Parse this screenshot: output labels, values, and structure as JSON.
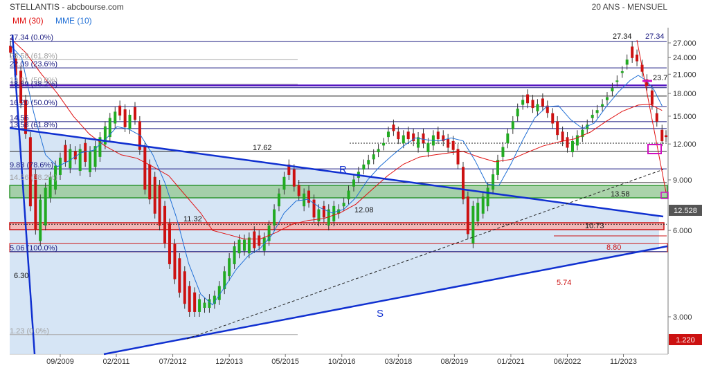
{
  "header": {
    "title": "STELLANTIS - abcbourse.com",
    "period": "20 ANS - MENSUEL"
  },
  "legend": [
    {
      "label": "MM (30)",
      "color": "#e01010"
    },
    {
      "label": "MME (10)",
      "color": "#1f6fd6"
    }
  ],
  "chart_data": {
    "type": "line",
    "title": "STELLANTIS - abcbourse.com",
    "subtitle": "20 ANS - MENSUEL",
    "y_scale": "log",
    "ylim": [
      2.55,
      28.5
    ],
    "y_ticks": [
      "27.000",
      "24.000",
      "21.000",
      "18.000",
      "15.000",
      "12.000",
      "9.000",
      "6.000",
      "3.000"
    ],
    "y_tick_values": [
      27,
      24,
      21,
      18,
      15,
      12,
      9,
      6,
      3
    ],
    "x_ticks": [
      "09/2009",
      "02/2011",
      "07/2012",
      "12/2013",
      "05/2015",
      "10/2016",
      "03/2018",
      "08/2019",
      "01/2021",
      "06/2022",
      "11/2023"
    ],
    "x_tick_dates": [
      2009.67,
      2011.08,
      2012.5,
      2013.92,
      2015.33,
      2016.75,
      2018.17,
      2019.58,
      2021.0,
      2022.42,
      2023.83
    ],
    "x_range": [
      2008.4,
      2024.9
    ],
    "last_value": "12.528",
    "low_marker": "1.220",
    "colors": {
      "price_up": "#22aa22",
      "price_down": "#cc1111",
      "mm30": "#e01010",
      "mme10": "#1f6fd6",
      "trend": "#1030d0",
      "fib": "#1a1a80",
      "fib_faint": "#a0a0a0"
    },
    "series": [
      {
        "name": "MM (30)",
        "color": "#e01010",
        "points": [
          [
            2008.42,
            28.0
          ],
          [
            2008.8,
            25.0
          ],
          [
            2009.2,
            21.0
          ],
          [
            2009.6,
            18.0
          ],
          [
            2010.0,
            15.0
          ],
          [
            2010.4,
            13.0
          ],
          [
            2010.8,
            11.8
          ],
          [
            2011.2,
            11.0
          ],
          [
            2011.6,
            10.7
          ],
          [
            2012.0,
            10.0
          ],
          [
            2012.4,
            9.3
          ],
          [
            2012.8,
            8.0
          ],
          [
            2013.2,
            6.9
          ],
          [
            2013.5,
            6.0
          ],
          [
            2013.9,
            5.8
          ],
          [
            2014.3,
            5.6
          ],
          [
            2014.7,
            5.6
          ],
          [
            2015.1,
            5.9
          ],
          [
            2015.5,
            6.3
          ],
          [
            2015.9,
            6.5
          ],
          [
            2016.3,
            6.6
          ],
          [
            2016.7,
            6.9
          ],
          [
            2017.1,
            7.4
          ],
          [
            2017.5,
            8.3
          ],
          [
            2017.9,
            9.3
          ],
          [
            2018.3,
            10.2
          ],
          [
            2018.7,
            10.8
          ],
          [
            2019.1,
            11.0
          ],
          [
            2019.5,
            11.2
          ],
          [
            2019.8,
            11.3
          ],
          [
            2020.2,
            10.8
          ],
          [
            2020.6,
            10.4
          ],
          [
            2021.0,
            10.6
          ],
          [
            2021.4,
            11.2
          ],
          [
            2021.8,
            11.8
          ],
          [
            2022.2,
            12.2
          ],
          [
            2022.6,
            12.5
          ],
          [
            2023.0,
            13.2
          ],
          [
            2023.4,
            14.4
          ],
          [
            2023.8,
            15.6
          ],
          [
            2024.2,
            16.4
          ],
          [
            2024.5,
            16.5
          ],
          [
            2024.8,
            15.7
          ]
        ]
      },
      {
        "name": "MME (10)",
        "color": "#1f6fd6",
        "points": [
          [
            2008.42,
            26.5
          ],
          [
            2008.7,
            24.0
          ],
          [
            2009.0,
            15.5
          ],
          [
            2009.3,
            11.0
          ],
          [
            2009.6,
            10.0
          ],
          [
            2009.9,
            10.5
          ],
          [
            2010.2,
            11.2
          ],
          [
            2010.5,
            11.4
          ],
          [
            2010.8,
            12.4
          ],
          [
            2011.1,
            13.8
          ],
          [
            2011.4,
            13.5
          ],
          [
            2011.7,
            12.8
          ],
          [
            2012.0,
            11.0
          ],
          [
            2012.3,
            8.8
          ],
          [
            2012.6,
            6.6
          ],
          [
            2012.9,
            4.6
          ],
          [
            2013.2,
            3.6
          ],
          [
            2013.5,
            3.3
          ],
          [
            2013.8,
            3.8
          ],
          [
            2014.1,
            4.4
          ],
          [
            2014.4,
            4.9
          ],
          [
            2014.7,
            5.2
          ],
          [
            2015.0,
            5.8
          ],
          [
            2015.3,
            6.9
          ],
          [
            2015.6,
            7.6
          ],
          [
            2015.9,
            7.7
          ],
          [
            2016.2,
            7.2
          ],
          [
            2016.5,
            6.9
          ],
          [
            2016.8,
            7.1
          ],
          [
            2017.1,
            7.8
          ],
          [
            2017.4,
            9.0
          ],
          [
            2017.7,
            10.0
          ],
          [
            2018.0,
            10.9
          ],
          [
            2018.3,
            11.8
          ],
          [
            2018.6,
            12.6
          ],
          [
            2018.9,
            12.4
          ],
          [
            2019.2,
            12.3
          ],
          [
            2019.5,
            12.6
          ],
          [
            2019.8,
            12.3
          ],
          [
            2020.1,
            10.5
          ],
          [
            2020.4,
            8.7
          ],
          [
            2020.7,
            8.6
          ],
          [
            2021.0,
            10.2
          ],
          [
            2021.3,
            12.4
          ],
          [
            2021.6,
            14.8
          ],
          [
            2021.9,
            16.2
          ],
          [
            2022.2,
            16.3
          ],
          [
            2022.5,
            14.6
          ],
          [
            2022.8,
            13.6
          ],
          [
            2023.1,
            14.2
          ],
          [
            2023.4,
            16.2
          ],
          [
            2023.7,
            18.2
          ],
          [
            2024.0,
            20.0
          ],
          [
            2024.2,
            20.8
          ],
          [
            2024.4,
            20.0
          ],
          [
            2024.6,
            18.5
          ],
          [
            2024.8,
            16.3
          ]
        ]
      }
    ],
    "price_candles": [
      [
        2008.42,
        27.5,
        24.0
      ],
      [
        2008.55,
        24.8,
        20.0
      ],
      [
        2008.68,
        22.5,
        16.0
      ],
      [
        2008.8,
        17.8,
        12.5
      ],
      [
        2008.92,
        13.2,
        7.0
      ],
      [
        2009.05,
        9.8,
        5.8
      ],
      [
        2009.17,
        8.0,
        5.3
      ],
      [
        2009.3,
        8.8,
        6.0
      ],
      [
        2009.42,
        9.6,
        7.5
      ],
      [
        2009.55,
        10.5,
        8.0
      ],
      [
        2009.67,
        11.2,
        9.0
      ],
      [
        2009.8,
        12.4,
        10.0
      ],
      [
        2009.92,
        12.0,
        9.5
      ],
      [
        2010.05,
        11.8,
        10.2
      ],
      [
        2010.17,
        12.0,
        9.3
      ],
      [
        2010.3,
        12.6,
        10.0
      ],
      [
        2010.42,
        11.8,
        9.2
      ],
      [
        2010.55,
        12.3,
        9.6
      ],
      [
        2010.67,
        13.2,
        10.4
      ],
      [
        2010.8,
        14.4,
        11.5
      ],
      [
        2010.92,
        15.4,
        12.2
      ],
      [
        2011.05,
        16.2,
        13.6
      ],
      [
        2011.17,
        17.0,
        14.5
      ],
      [
        2011.3,
        16.5,
        13.2
      ],
      [
        2011.42,
        15.8,
        13.0
      ],
      [
        2011.55,
        16.8,
        14.0
      ],
      [
        2011.67,
        15.0,
        11.0
      ],
      [
        2011.8,
        12.2,
        8.0
      ],
      [
        2011.92,
        10.6,
        7.4
      ],
      [
        2012.05,
        9.6,
        6.6
      ],
      [
        2012.17,
        9.0,
        6.0
      ],
      [
        2012.3,
        7.6,
        5.2
      ],
      [
        2012.42,
        6.6,
        4.4
      ],
      [
        2012.55,
        5.6,
        3.9
      ],
      [
        2012.67,
        5.0,
        3.5
      ],
      [
        2012.8,
        4.5,
        3.2
      ],
      [
        2012.92,
        4.0,
        3.0
      ],
      [
        2013.05,
        3.8,
        3.0
      ],
      [
        2013.17,
        3.6,
        3.0
      ],
      [
        2013.3,
        3.5,
        3.1
      ],
      [
        2013.42,
        3.6,
        3.1
      ],
      [
        2013.55,
        3.7,
        3.2
      ],
      [
        2013.67,
        4.0,
        3.3
      ],
      [
        2013.8,
        4.5,
        3.6
      ],
      [
        2013.92,
        5.0,
        4.0
      ],
      [
        2014.05,
        5.5,
        4.4
      ],
      [
        2014.17,
        5.8,
        4.8
      ],
      [
        2014.3,
        5.8,
        4.9
      ],
      [
        2014.42,
        5.9,
        4.8
      ],
      [
        2014.55,
        6.2,
        5.0
      ],
      [
        2014.67,
        6.0,
        5.1
      ],
      [
        2014.8,
        5.9,
        4.9
      ],
      [
        2014.92,
        6.5,
        5.3
      ],
      [
        2015.05,
        7.4,
        6.0
      ],
      [
        2015.17,
        8.4,
        7.0
      ],
      [
        2015.3,
        9.6,
        8.0
      ],
      [
        2015.42,
        10.6,
        9.0
      ],
      [
        2015.55,
        10.2,
        8.2
      ],
      [
        2015.67,
        9.0,
        7.6
      ],
      [
        2015.8,
        8.4,
        7.0
      ],
      [
        2015.92,
        8.6,
        7.2
      ],
      [
        2016.05,
        8.0,
        6.4
      ],
      [
        2016.17,
        7.4,
        6.2
      ],
      [
        2016.3,
        7.6,
        6.4
      ],
      [
        2016.42,
        7.4,
        6.0
      ],
      [
        2016.55,
        7.6,
        6.2
      ],
      [
        2016.67,
        7.4,
        6.6
      ],
      [
        2016.8,
        7.8,
        7.0
      ],
      [
        2016.92,
        8.6,
        7.4
      ],
      [
        2017.05,
        9.4,
        8.2
      ],
      [
        2017.17,
        10.0,
        8.8
      ],
      [
        2017.3,
        10.6,
        9.4
      ],
      [
        2017.42,
        11.0,
        9.8
      ],
      [
        2017.55,
        11.5,
        10.2
      ],
      [
        2017.67,
        12.0,
        10.8
      ],
      [
        2017.8,
        12.6,
        11.4
      ],
      [
        2017.92,
        13.8,
        12.2
      ],
      [
        2018.05,
        14.6,
        12.8
      ],
      [
        2018.17,
        13.8,
        12.0
      ],
      [
        2018.3,
        13.4,
        11.6
      ],
      [
        2018.42,
        13.8,
        12.0
      ],
      [
        2018.55,
        13.6,
        11.8
      ],
      [
        2018.67,
        13.2,
        11.2
      ],
      [
        2018.8,
        13.6,
        11.6
      ],
      [
        2018.92,
        12.6,
        10.8
      ],
      [
        2019.05,
        13.4,
        11.4
      ],
      [
        2019.17,
        13.8,
        12.0
      ],
      [
        2019.3,
        13.4,
        11.8
      ],
      [
        2019.42,
        13.0,
        11.2
      ],
      [
        2019.55,
        12.8,
        11.0
      ],
      [
        2019.67,
        12.0,
        9.8
      ],
      [
        2019.8,
        10.4,
        7.4
      ],
      [
        2019.92,
        8.2,
        5.6
      ],
      [
        2020.05,
        7.6,
        5.2
      ],
      [
        2020.17,
        7.8,
        6.2
      ],
      [
        2020.3,
        8.2,
        6.6
      ],
      [
        2020.42,
        8.8,
        7.0
      ],
      [
        2020.55,
        9.8,
        8.0
      ],
      [
        2020.67,
        11.0,
        9.0
      ],
      [
        2020.8,
        12.2,
        10.4
      ],
      [
        2020.92,
        13.6,
        11.6
      ],
      [
        2021.05,
        15.0,
        13.0
      ],
      [
        2021.17,
        16.6,
        14.4
      ],
      [
        2021.3,
        17.8,
        15.8
      ],
      [
        2021.42,
        18.6,
        16.0
      ],
      [
        2021.55,
        17.8,
        15.4
      ],
      [
        2021.67,
        17.2,
        15.0
      ],
      [
        2021.8,
        18.0,
        15.6
      ],
      [
        2021.92,
        17.0,
        14.8
      ],
      [
        2022.05,
        16.0,
        13.6
      ],
      [
        2022.17,
        15.0,
        12.4
      ],
      [
        2022.3,
        13.8,
        11.8
      ],
      [
        2022.42,
        13.2,
        11.2
      ],
      [
        2022.55,
        12.8,
        10.8
      ],
      [
        2022.67,
        13.4,
        11.4
      ],
      [
        2022.8,
        14.0,
        12.2
      ],
      [
        2022.92,
        14.6,
        13.0
      ],
      [
        2023.05,
        15.8,
        14.2
      ],
      [
        2023.17,
        16.4,
        14.8
      ],
      [
        2023.3,
        17.2,
        15.6
      ],
      [
        2023.42,
        18.2,
        16.4
      ],
      [
        2023.55,
        19.6,
        17.6
      ],
      [
        2023.67,
        20.8,
        19.0
      ],
      [
        2023.8,
        22.4,
        20.4
      ],
      [
        2023.92,
        24.6,
        21.8
      ],
      [
        2024.05,
        27.3,
        23.0
      ],
      [
        2024.17,
        25.6,
        22.4
      ],
      [
        2024.3,
        23.6,
        20.6
      ],
      [
        2024.42,
        21.0,
        18.4
      ],
      [
        2024.55,
        19.2,
        15.8
      ],
      [
        2024.67,
        16.0,
        13.8
      ],
      [
        2024.8,
        14.0,
        11.8
      ],
      [
        2024.9,
        13.4,
        12.2
      ]
    ]
  },
  "fib_left": [
    {
      "label": "27.34  (0.0%)",
      "value": 27.34,
      "style": "dark"
    },
    {
      "label": "23.58  (61.8%)",
      "value": 23.58,
      "style": "faint"
    },
    {
      "label": "22.09  (23.6%)",
      "value": 22.09,
      "style": "dark"
    },
    {
      "label": "19.91  (50.0%)",
      "value": 19.4,
      "style": "faint"
    },
    {
      "label": "18.89  (38.2%)",
      "value": 18.85,
      "style": "dark"
    },
    {
      "label": "16.20  (50.0%)",
      "value": 16.2,
      "style": "dark"
    },
    {
      "label": "14.56",
      "value": 14.35,
      "style": "dark"
    },
    {
      "label": "13.58  (61.8%)",
      "value": 13.58,
      "style": "dark"
    },
    {
      "label": "9.83  (78.6%)",
      "value": 9.83,
      "style": "dark"
    },
    {
      "label": "5.06  (100.0%)",
      "value": 5.06,
      "style": "dark"
    },
    {
      "label": "1.23  (0.0%)",
      "value": 2.6,
      "style": "faint"
    }
  ],
  "annotations": {
    "high_label": "27.34",
    "high_right": "27.34",
    "level_23_7": "23.7",
    "level_17_62": "17.62",
    "level_13_58": "13.58",
    "level_12_08": "12.08",
    "level_11_32": "11.32",
    "level_10_73": "10.73",
    "level_8_80": "8.80",
    "level_6_30": "6.30",
    "level_5_74": "5.74",
    "faint_38": "14.56  (38.2%)",
    "letter_r": "R",
    "letter_s": "S"
  }
}
